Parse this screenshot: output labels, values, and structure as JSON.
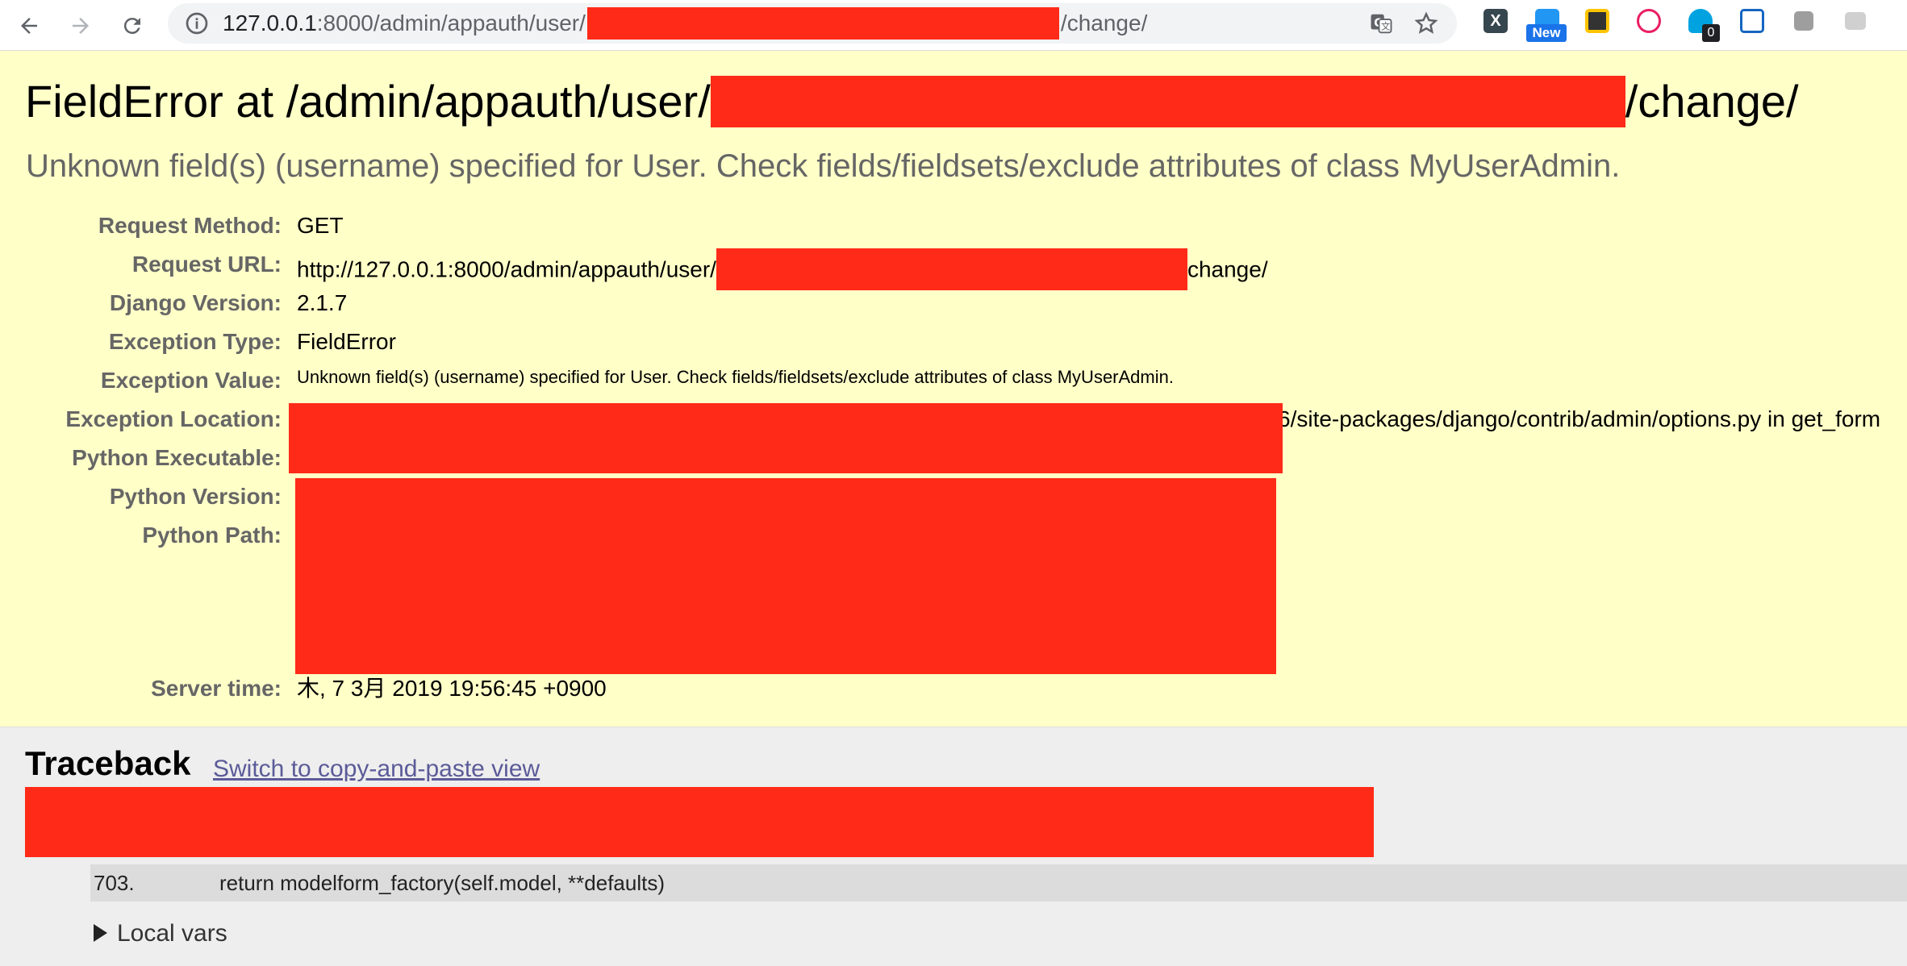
{
  "browser": {
    "url_host": "127.0.0.1",
    "url_path_prefix": ":8000/admin/appauth/user/",
    "url_path_suffix": "/change/",
    "extension_new_badge": "New",
    "extension_count_badge": "0",
    "icons": [
      "back-arrow-icon",
      "forward-arrow-icon",
      "reload-icon",
      "info-icon",
      "translate-icon",
      "star-icon"
    ]
  },
  "error": {
    "title_prefix": "FieldError at /admin/appauth/user/",
    "title_suffix": "/change/",
    "subtitle": "Unknown field(s) (username) specified for User. Check fields/fieldsets/exclude attributes of class MyUserAdmin."
  },
  "meta": {
    "request_method_label": "Request Method:",
    "request_method": "GET",
    "request_url_label": "Request URL:",
    "request_url_prefix": "http://127.0.0.1:8000/admin/appauth/user/",
    "request_url_suffix": "change/",
    "django_version_label": "Django Version:",
    "django_version": "2.1.7",
    "exception_type_label": "Exception Type:",
    "exception_type": "FieldError",
    "exception_value_label": "Exception Value:",
    "exception_value": "Unknown field(s) (username) specified for User. Check fields/fieldsets/exclude attributes of class MyUserAdmin.",
    "exception_location_label": "Exception Location:",
    "exception_location_visible": "6/site-packages/django/contrib/admin/options.py in get_form",
    "python_executable_label": "Python Executable:",
    "python_version_label": "Python Version:",
    "python_path_label": "Python Path:",
    "server_time_label": "Server time:",
    "server_time": "木, 7 3月 2019 19:56:45 +0900"
  },
  "traceback": {
    "title": "Traceback",
    "switch_link": "Switch to copy-and-paste view",
    "line_number": "703.",
    "code_line": "return modelform_factory(self.model, **defaults)",
    "local_vars": "Local vars"
  },
  "colors": {
    "redaction": "#ff2a17",
    "summary_bg": "#ffffc8",
    "traceback_bg": "#eeeeee"
  }
}
